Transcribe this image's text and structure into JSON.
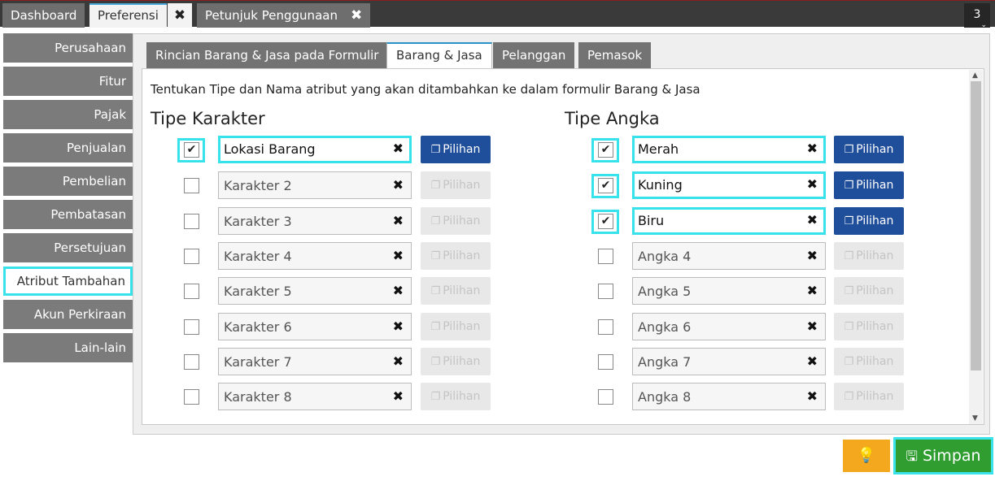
{
  "tabs": [
    {
      "label": "Dashboard"
    },
    {
      "label": "Preferensi"
    },
    {
      "label": "Petunjuk Penggunaan"
    }
  ],
  "tab_close_symbol": "✖",
  "tab_count": "3",
  "sidebar": {
    "items": [
      {
        "label": "Perusahaan"
      },
      {
        "label": "Fitur"
      },
      {
        "label": "Pajak"
      },
      {
        "label": "Penjualan"
      },
      {
        "label": "Pembelian"
      },
      {
        "label": "Pembatasan"
      },
      {
        "label": "Persetujuan"
      },
      {
        "label": "Atribut Tambahan"
      },
      {
        "label": "Akun Perkiraan"
      },
      {
        "label": "Lain-lain"
      }
    ],
    "active_index": 7
  },
  "panel_tabs": [
    {
      "label": "Rincian Barang & Jasa pada Formulir"
    },
    {
      "label": "Barang & Jasa"
    },
    {
      "label": "Pelanggan"
    },
    {
      "label": "Pemasok"
    }
  ],
  "instruction": "Tentukan Tipe dan Nama atribut yang akan ditambahkan ke dalam formulir Barang & Jasa",
  "char_section": {
    "heading": "Tipe Karakter",
    "rows": [
      {
        "checked": true,
        "value": "Lokasi Barang",
        "enabled": true
      },
      {
        "checked": false,
        "value": "Karakter 2",
        "enabled": false
      },
      {
        "checked": false,
        "value": "Karakter 3",
        "enabled": false
      },
      {
        "checked": false,
        "value": "Karakter 4",
        "enabled": false
      },
      {
        "checked": false,
        "value": "Karakter 5",
        "enabled": false
      },
      {
        "checked": false,
        "value": "Karakter 6",
        "enabled": false
      },
      {
        "checked": false,
        "value": "Karakter 7",
        "enabled": false
      },
      {
        "checked": false,
        "value": "Karakter 8",
        "enabled": false
      }
    ]
  },
  "num_section": {
    "heading": "Tipe Angka",
    "rows": [
      {
        "checked": true,
        "value": "Merah",
        "enabled": true
      },
      {
        "checked": true,
        "value": "Kuning",
        "enabled": true
      },
      {
        "checked": true,
        "value": "Biru",
        "enabled": true
      },
      {
        "checked": false,
        "value": "Angka 4",
        "enabled": false
      },
      {
        "checked": false,
        "value": "Angka 5",
        "enabled": false
      },
      {
        "checked": false,
        "value": "Angka 6",
        "enabled": false
      },
      {
        "checked": false,
        "value": "Angka 7",
        "enabled": false
      },
      {
        "checked": false,
        "value": "Angka 8",
        "enabled": false
      }
    ]
  },
  "pilihan_label": "Pilihan",
  "clear_symbol": "✖",
  "check_symbol": "✔",
  "save_label": "Simpan",
  "colors": {
    "highlight": "#37e2ea",
    "primary_button": "#1f4e9b",
    "save_button": "#2f9d2f",
    "idea_button": "#f4a81d",
    "sidebar_bg": "#7b7b7b"
  }
}
